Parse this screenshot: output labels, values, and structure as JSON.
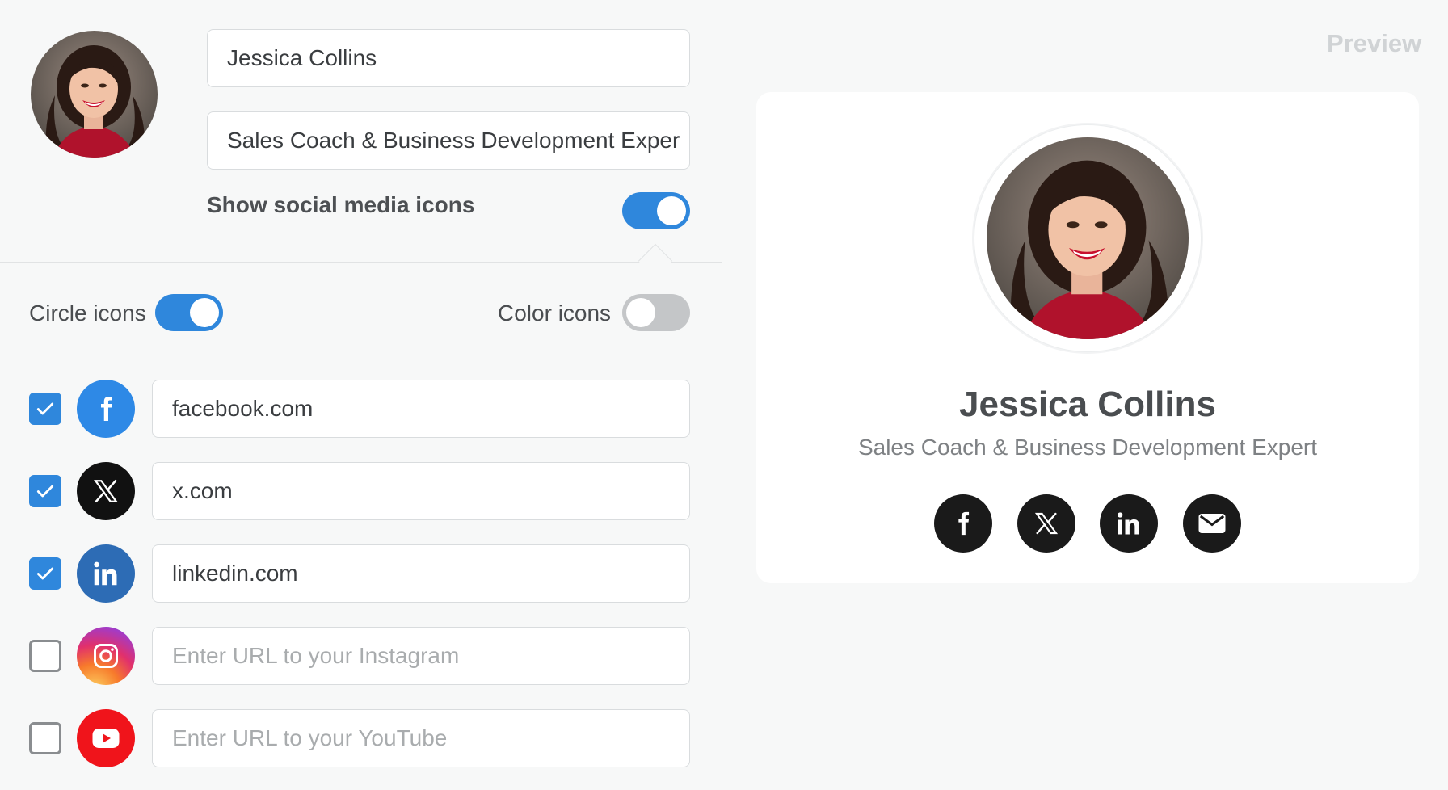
{
  "profile": {
    "name": "Jessica Collins",
    "title": "Sales Coach & Business Development Expert",
    "title_field_visible": "Sales Coach & Business Development Exper"
  },
  "settings": {
    "show_social_label": "Show social media icons",
    "show_social_on": true,
    "circle_icons_label": "Circle icons",
    "circle_icons_on": true,
    "color_icons_label": "Color icons",
    "color_icons_on": false
  },
  "networks": [
    {
      "name": "facebook",
      "icon": "facebook-icon",
      "checked": true,
      "value": "facebook.com",
      "placeholder": "",
      "color": "#2e89e6"
    },
    {
      "name": "x",
      "icon": "x-icon",
      "checked": true,
      "value": "x.com",
      "placeholder": "",
      "color": "#111111"
    },
    {
      "name": "linkedin",
      "icon": "linkedin-icon",
      "checked": true,
      "value": "linkedin.com",
      "placeholder": "",
      "color": "#2d6cb5"
    },
    {
      "name": "instagram",
      "icon": "instagram-icon",
      "checked": false,
      "value": "",
      "placeholder": "Enter URL to your Instagram",
      "color": "#e1306c"
    },
    {
      "name": "youtube",
      "icon": "youtube-icon",
      "checked": false,
      "value": "",
      "placeholder": "Enter URL to your YouTube",
      "color": "#f0141b"
    }
  ],
  "preview": {
    "label": "Preview",
    "icons": [
      "facebook-icon",
      "x-icon",
      "linkedin-icon",
      "mail-icon"
    ]
  },
  "colors": {
    "accent": "#2f87dc",
    "toggle_off": "#c4c6c8"
  }
}
